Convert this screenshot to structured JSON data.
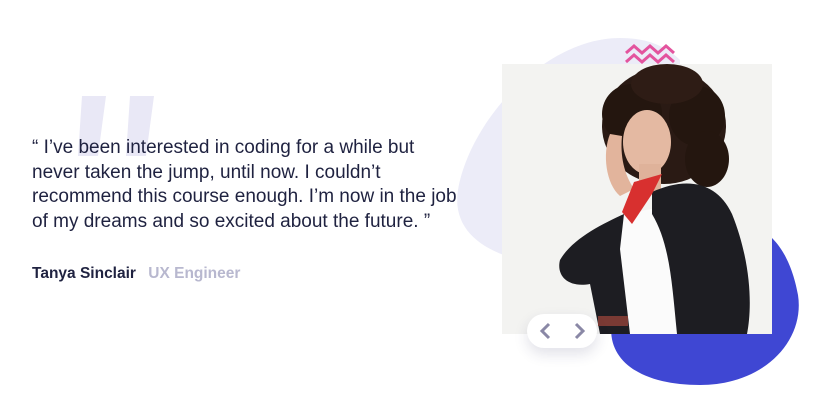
{
  "testimonial": {
    "quote": "“ I’ve been interested in coding for a while but never taken the jump, until now. I couldn’t recommend this course enough. I’m now in the job of my dreams and so excited about the future. ”",
    "author_name": "Tanya Sinclair",
    "author_role": "UX Engineer"
  },
  "icons": {
    "quote_mark": "quote-icon",
    "previous": "chevron-left-icon",
    "next": "chevron-right-icon",
    "decoration": "zigzag-pattern-icon"
  },
  "colors": {
    "text_dark": "#1f2240",
    "text_muted": "#b8b8cf",
    "quote_mark": "#e9e8f6",
    "blob_light": "#ececf8",
    "blob_blue": "#3f47d3",
    "accent_pink": "#e3549e",
    "chevron": "#8a88a6"
  }
}
